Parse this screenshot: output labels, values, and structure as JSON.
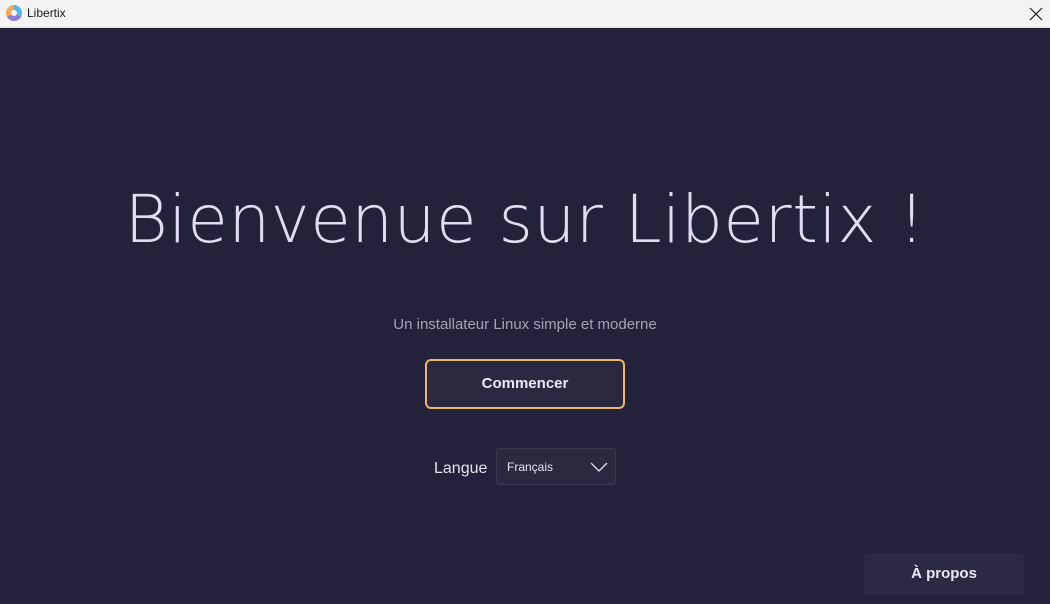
{
  "window": {
    "title": "Libertix",
    "icon": "libertix-logo-icon",
    "close_icon": "close-icon"
  },
  "welcome": {
    "title": "Bienvenue sur Libertix !",
    "subtitle": "Un installateur Linux simple et moderne",
    "start_button": "Commencer"
  },
  "language": {
    "label": "Langue",
    "selected": "Français",
    "dropdown_icon": "chevron-down-icon"
  },
  "footer": {
    "about_button": "À propos"
  },
  "colors": {
    "background": "#23223a",
    "accent_border": "#e9b86b",
    "title_text": "#e2dcf2",
    "titlebar": "#f3f3f3"
  }
}
